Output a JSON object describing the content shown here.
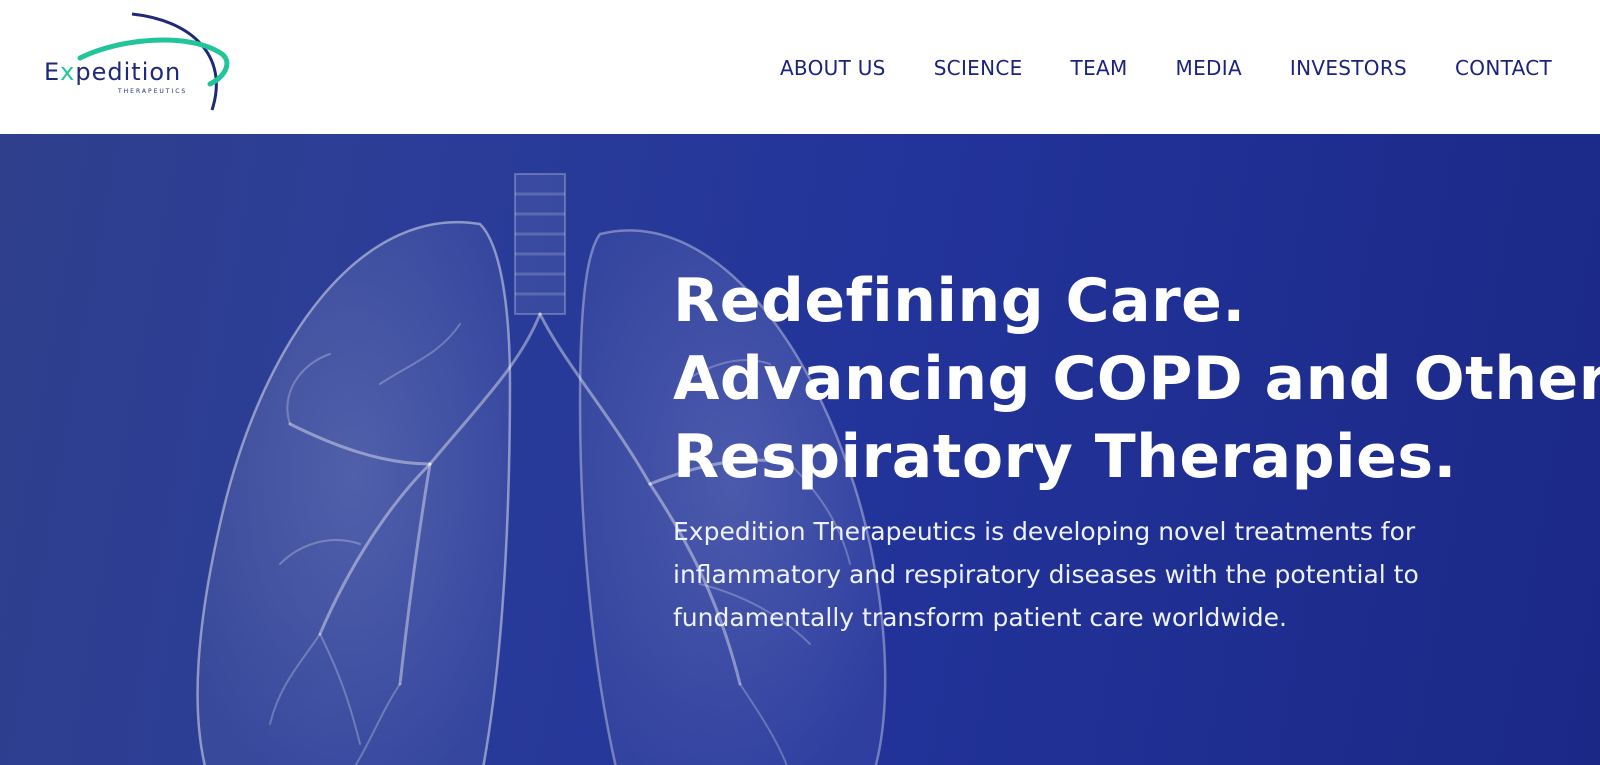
{
  "brand": {
    "name_prefix": "E",
    "name_x": "x",
    "name_rest": "pedition",
    "subtitle": "THERAPEUTICS",
    "logo_icon": "orbit-swoosh-icon",
    "colors": {
      "navy": "#1e2a78",
      "green": "#22c59a"
    }
  },
  "nav": {
    "items": [
      {
        "label": "ABOUT US"
      },
      {
        "label": "SCIENCE"
      },
      {
        "label": "TEAM"
      },
      {
        "label": "MEDIA"
      },
      {
        "label": "INVESTORS"
      },
      {
        "label": "CONTACT"
      }
    ],
    "color": "#1a237e"
  },
  "hero": {
    "headline_lines": [
      "Redefining Care.",
      "Advancing COPD and Other",
      "Respiratory Therapies."
    ],
    "description": "Expedition Therapeutics is developing novel treatments for inflammatory and respiratory diseases with the potential to fundamentally transform patient care worldwide.",
    "background_image": "lungs-illustration",
    "colors": {
      "bg_start": "#2f3f8c",
      "bg_end": "#1b2886"
    }
  }
}
